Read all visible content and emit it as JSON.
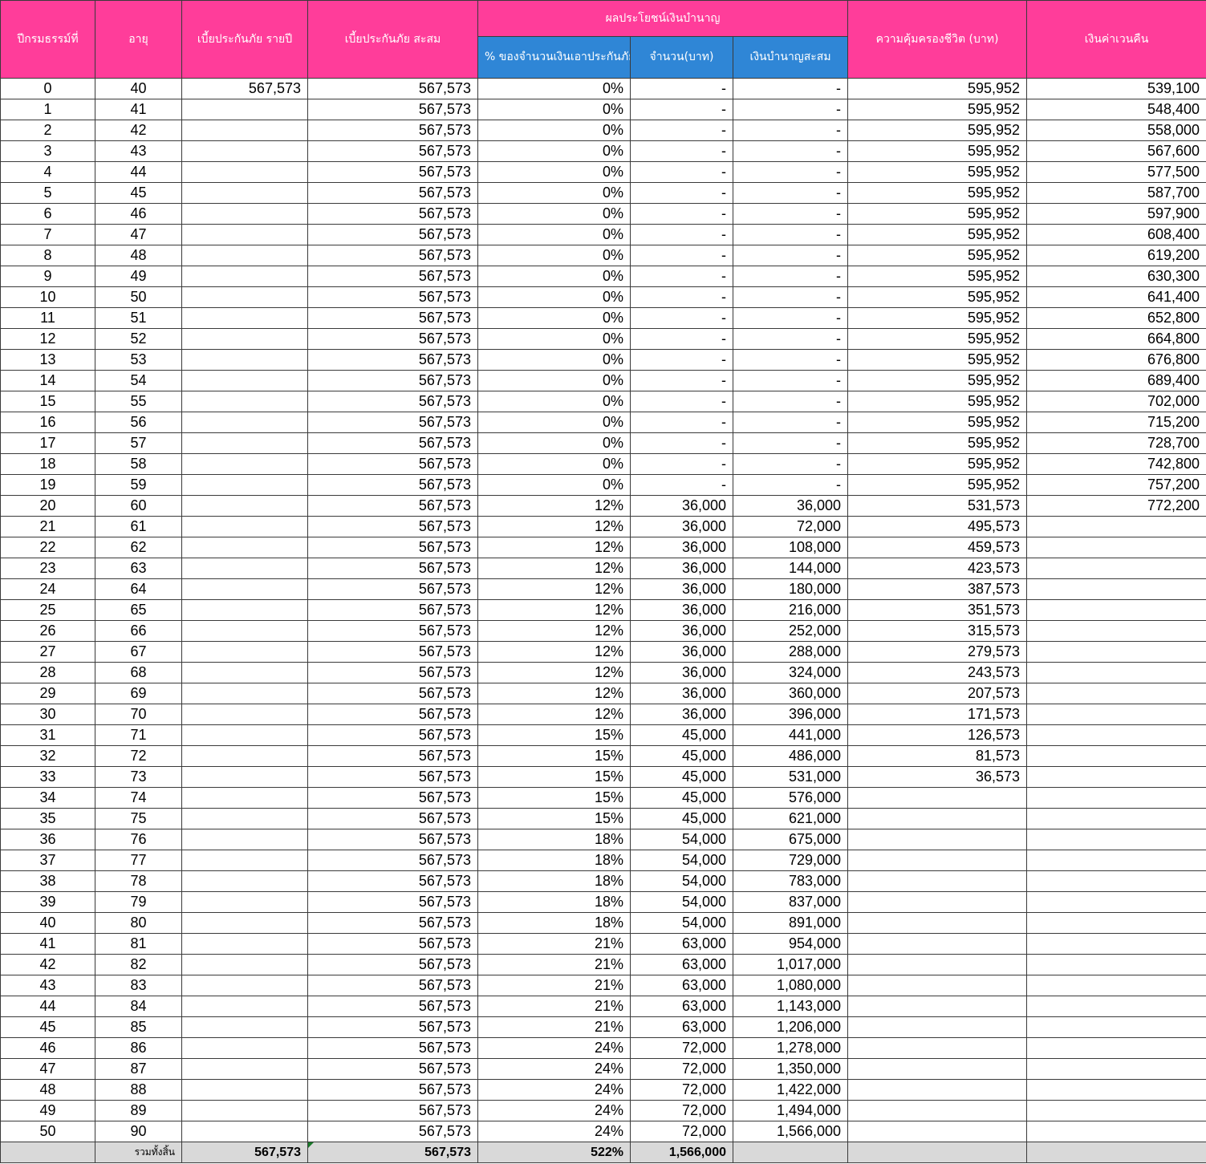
{
  "headers": {
    "policy_year": "ปีกรมธรรม์ที่",
    "age": "อายุ",
    "annual_premium": "เบี้ยประกันภัย รายปี",
    "cumulative_premium": "เบี้ยประกันภัย สะสม",
    "pension_group": "ผลประโยชน์เงินบำนาญ",
    "pension_percent": "% ของจำนวนเงินเอาประกันภัย ณ วันเริ่มสัญญา",
    "pension_amount": "จำนวน(บาท)",
    "pension_cumulative": "เงินบำนาญสะสม",
    "life_coverage": "ความคุ้มครองชีวิต (บาท)",
    "surrender_value": "เงินค่าเวนคืน"
  },
  "rows": [
    [
      "0",
      "40",
      "567,573",
      "567,573",
      "0%",
      "-",
      "-",
      "595,952",
      "539,100"
    ],
    [
      "1",
      "41",
      "",
      "567,573",
      "0%",
      "-",
      "-",
      "595,952",
      "548,400"
    ],
    [
      "2",
      "42",
      "",
      "567,573",
      "0%",
      "-",
      "-",
      "595,952",
      "558,000"
    ],
    [
      "3",
      "43",
      "",
      "567,573",
      "0%",
      "-",
      "-",
      "595,952",
      "567,600"
    ],
    [
      "4",
      "44",
      "",
      "567,573",
      "0%",
      "-",
      "-",
      "595,952",
      "577,500"
    ],
    [
      "5",
      "45",
      "",
      "567,573",
      "0%",
      "-",
      "-",
      "595,952",
      "587,700"
    ],
    [
      "6",
      "46",
      "",
      "567,573",
      "0%",
      "-",
      "-",
      "595,952",
      "597,900"
    ],
    [
      "7",
      "47",
      "",
      "567,573",
      "0%",
      "-",
      "-",
      "595,952",
      "608,400"
    ],
    [
      "8",
      "48",
      "",
      "567,573",
      "0%",
      "-",
      "-",
      "595,952",
      "619,200"
    ],
    [
      "9",
      "49",
      "",
      "567,573",
      "0%",
      "-",
      "-",
      "595,952",
      "630,300"
    ],
    [
      "10",
      "50",
      "",
      "567,573",
      "0%",
      "-",
      "-",
      "595,952",
      "641,400"
    ],
    [
      "11",
      "51",
      "",
      "567,573",
      "0%",
      "-",
      "-",
      "595,952",
      "652,800"
    ],
    [
      "12",
      "52",
      "",
      "567,573",
      "0%",
      "-",
      "-",
      "595,952",
      "664,800"
    ],
    [
      "13",
      "53",
      "",
      "567,573",
      "0%",
      "-",
      "-",
      "595,952",
      "676,800"
    ],
    [
      "14",
      "54",
      "",
      "567,573",
      "0%",
      "-",
      "-",
      "595,952",
      "689,400"
    ],
    [
      "15",
      "55",
      "",
      "567,573",
      "0%",
      "-",
      "-",
      "595,952",
      "702,000"
    ],
    [
      "16",
      "56",
      "",
      "567,573",
      "0%",
      "-",
      "-",
      "595,952",
      "715,200"
    ],
    [
      "17",
      "57",
      "",
      "567,573",
      "0%",
      "-",
      "-",
      "595,952",
      "728,700"
    ],
    [
      "18",
      "58",
      "",
      "567,573",
      "0%",
      "-",
      "-",
      "595,952",
      "742,800"
    ],
    [
      "19",
      "59",
      "",
      "567,573",
      "0%",
      "-",
      "-",
      "595,952",
      "757,200"
    ],
    [
      "20",
      "60",
      "",
      "567,573",
      "12%",
      "36,000",
      "36,000",
      "531,573",
      "772,200"
    ],
    [
      "21",
      "61",
      "",
      "567,573",
      "12%",
      "36,000",
      "72,000",
      "495,573",
      ""
    ],
    [
      "22",
      "62",
      "",
      "567,573",
      "12%",
      "36,000",
      "108,000",
      "459,573",
      ""
    ],
    [
      "23",
      "63",
      "",
      "567,573",
      "12%",
      "36,000",
      "144,000",
      "423,573",
      ""
    ],
    [
      "24",
      "64",
      "",
      "567,573",
      "12%",
      "36,000",
      "180,000",
      "387,573",
      ""
    ],
    [
      "25",
      "65",
      "",
      "567,573",
      "12%",
      "36,000",
      "216,000",
      "351,573",
      ""
    ],
    [
      "26",
      "66",
      "",
      "567,573",
      "12%",
      "36,000",
      "252,000",
      "315,573",
      ""
    ],
    [
      "27",
      "67",
      "",
      "567,573",
      "12%",
      "36,000",
      "288,000",
      "279,573",
      ""
    ],
    [
      "28",
      "68",
      "",
      "567,573",
      "12%",
      "36,000",
      "324,000",
      "243,573",
      ""
    ],
    [
      "29",
      "69",
      "",
      "567,573",
      "12%",
      "36,000",
      "360,000",
      "207,573",
      ""
    ],
    [
      "30",
      "70",
      "",
      "567,573",
      "12%",
      "36,000",
      "396,000",
      "171,573",
      ""
    ],
    [
      "31",
      "71",
      "",
      "567,573",
      "15%",
      "45,000",
      "441,000",
      "126,573",
      ""
    ],
    [
      "32",
      "72",
      "",
      "567,573",
      "15%",
      "45,000",
      "486,000",
      "81,573",
      ""
    ],
    [
      "33",
      "73",
      "",
      "567,573",
      "15%",
      "45,000",
      "531,000",
      "36,573",
      ""
    ],
    [
      "34",
      "74",
      "",
      "567,573",
      "15%",
      "45,000",
      "576,000",
      "",
      ""
    ],
    [
      "35",
      "75",
      "",
      "567,573",
      "15%",
      "45,000",
      "621,000",
      "",
      ""
    ],
    [
      "36",
      "76",
      "",
      "567,573",
      "18%",
      "54,000",
      "675,000",
      "",
      ""
    ],
    [
      "37",
      "77",
      "",
      "567,573",
      "18%",
      "54,000",
      "729,000",
      "",
      ""
    ],
    [
      "38",
      "78",
      "",
      "567,573",
      "18%",
      "54,000",
      "783,000",
      "",
      ""
    ],
    [
      "39",
      "79",
      "",
      "567,573",
      "18%",
      "54,000",
      "837,000",
      "",
      ""
    ],
    [
      "40",
      "80",
      "",
      "567,573",
      "18%",
      "54,000",
      "891,000",
      "",
      ""
    ],
    [
      "41",
      "81",
      "",
      "567,573",
      "21%",
      "63,000",
      "954,000",
      "",
      ""
    ],
    [
      "42",
      "82",
      "",
      "567,573",
      "21%",
      "63,000",
      "1,017,000",
      "",
      ""
    ],
    [
      "43",
      "83",
      "",
      "567,573",
      "21%",
      "63,000",
      "1,080,000",
      "",
      ""
    ],
    [
      "44",
      "84",
      "",
      "567,573",
      "21%",
      "63,000",
      "1,143,000",
      "",
      ""
    ],
    [
      "45",
      "85",
      "",
      "567,573",
      "21%",
      "63,000",
      "1,206,000",
      "",
      ""
    ],
    [
      "46",
      "86",
      "",
      "567,573",
      "24%",
      "72,000",
      "1,278,000",
      "",
      ""
    ],
    [
      "47",
      "87",
      "",
      "567,573",
      "24%",
      "72,000",
      "1,350,000",
      "",
      ""
    ],
    [
      "48",
      "88",
      "",
      "567,573",
      "24%",
      "72,000",
      "1,422,000",
      "",
      ""
    ],
    [
      "49",
      "89",
      "",
      "567,573",
      "24%",
      "72,000",
      "1,494,000",
      "",
      ""
    ],
    [
      "50",
      "90",
      "",
      "567,573",
      "24%",
      "72,000",
      "1,566,000",
      "",
      ""
    ]
  ],
  "totals": {
    "label": "รวมทั้งสิ้น",
    "annual_premium": "567,573",
    "cumulative_premium": "567,573",
    "pension_percent": "522%",
    "pension_amount": "1,566,000"
  },
  "colors": {
    "header_pink": "#ff3d9a",
    "header_blue": "#2f86d6",
    "total_row": "#d9d9d9"
  }
}
